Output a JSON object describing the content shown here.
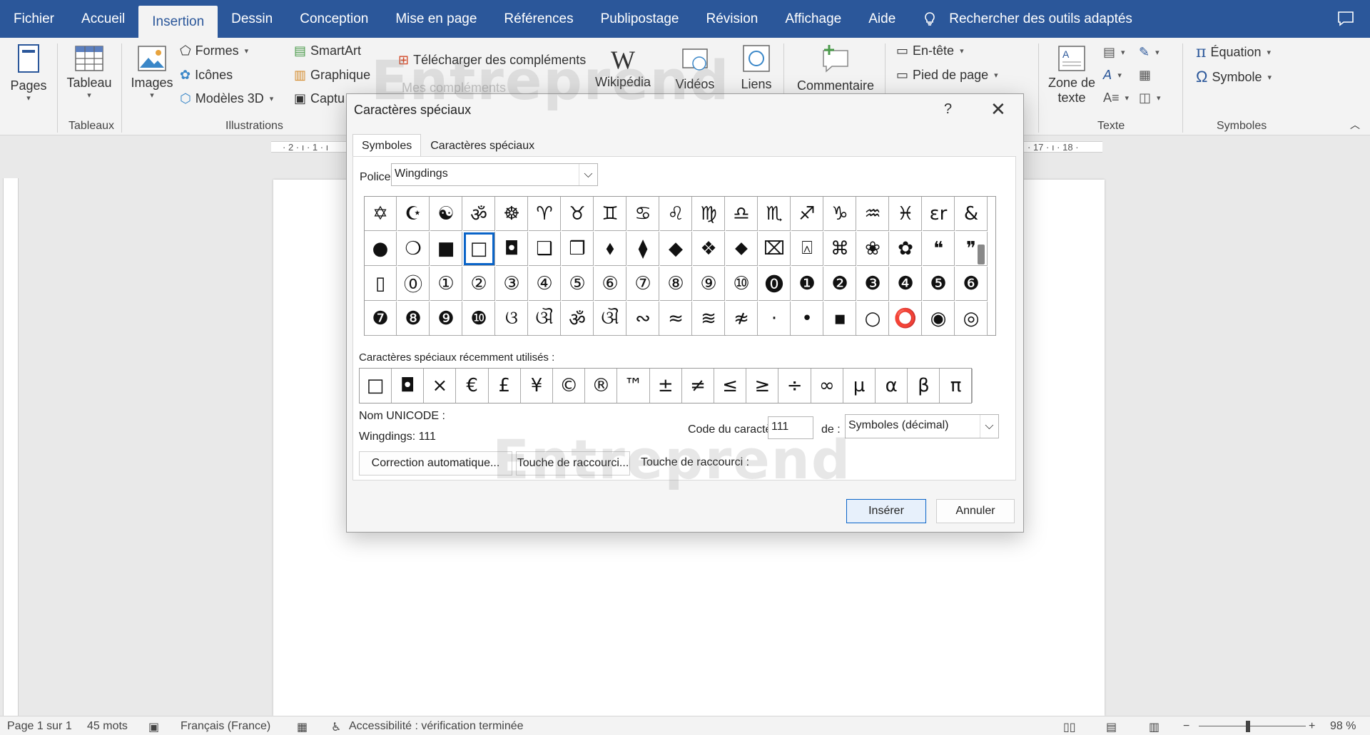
{
  "menu": {
    "items": [
      "Fichier",
      "Accueil",
      "Insertion",
      "Dessin",
      "Conception",
      "Mise en page",
      "Références",
      "Publipostage",
      "Révision",
      "Affichage",
      "Aide"
    ],
    "active": "Insertion",
    "search": "Rechercher des outils adaptés"
  },
  "ribbon": {
    "pages": "Pages",
    "tableau": "Tableau",
    "images": "Images",
    "formes": "Formes",
    "icones": "Icônes",
    "modeles3d": "Modèles 3D",
    "smartart": "SmartArt",
    "graphique": "Graphique",
    "capture": "Captu",
    "complements": "Télécharger des compléments",
    "mes_complements": "Mes compléments",
    "wikipedia": "Wikipédia",
    "videos": "Vidéos",
    "liens": "Liens",
    "commentaire": "Commentaire",
    "entete": "En-tête",
    "pied": "Pied de page",
    "zone_line1": "Zone de",
    "zone_line2": "texte",
    "equation": "Équation",
    "symbole": "Symbole",
    "groups": {
      "tableaux": "Tableaux",
      "illustrations": "Illustrations",
      "texte": "Texte",
      "symboles": "Symboles"
    }
  },
  "ruler": {
    "left": "· 2 · ı · 1 · ı",
    "right": "· 17 · ı · 18 ·"
  },
  "dialog": {
    "title": "Caractères spéciaux",
    "help": "?",
    "tabs": [
      "Symboles",
      "Caractères spéciaux"
    ],
    "font_label": "Police :",
    "font_value": "Wingdings",
    "symbol_rows": [
      [
        "✡",
        "☪",
        "☯",
        "ॐ",
        "☸",
        "♈",
        "♉",
        "♊",
        "♋",
        "♌",
        "♍",
        "♎",
        "♏",
        "♐",
        "♑",
        "♒",
        "♓",
        "ɛr",
        "&"
      ],
      [
        "●",
        "❍",
        "■",
        "□",
        "◘",
        "❑",
        "❒",
        "⬧",
        "⧫",
        "◆",
        "❖",
        "⬥",
        "⌧",
        "⍓",
        "⌘",
        "❀",
        "✿",
        "❝",
        "❞"
      ],
      [
        "▯",
        "⓪",
        "①",
        "②",
        "③",
        "④",
        "⑤",
        "⑥",
        "⑦",
        "⑧",
        "⑨",
        "⑩",
        "⓿",
        "❶",
        "❷",
        "❸",
        "❹",
        "❺",
        "❻"
      ],
      [
        "❼",
        "❽",
        "❾",
        "❿",
        "ଓ",
        "ଔ",
        "ॐ",
        "ଔ",
        "∾",
        "≈",
        "≋",
        "≉",
        "·",
        "•",
        "▪",
        "○",
        "⭕",
        "◉",
        "◎"
      ]
    ],
    "selected": {
      "row": 1,
      "col": 3
    },
    "recent_label": "Caractères spéciaux récemment utilisés :",
    "recent": [
      "□",
      "◘",
      "×",
      "€",
      "£",
      "¥",
      "©",
      "®",
      "™",
      "±",
      "≠",
      "≤",
      "≥",
      "÷",
      "∞",
      "µ",
      "α",
      "β",
      "π"
    ],
    "unicode_name_label": "Nom UNICODE :",
    "char_info": "Wingdings: 111",
    "code_label": "Code du caractère :",
    "code_value": "111",
    "de_label": "de :",
    "de_value": "Symboles (décimal)",
    "autocorrect": "Correction automatique...",
    "shortcut_btn": "Touche de raccourci...",
    "shortcut_label": "Touche de raccourci :",
    "insert": "Insérer",
    "cancel": "Annuler"
  },
  "watermark": "Entreprend",
  "status": {
    "page": "Page 1 sur 1",
    "words": "45 mots",
    "language": "Français (France)",
    "accessibility": "Accessibilité : vérification terminée",
    "zoom": "98 %"
  }
}
